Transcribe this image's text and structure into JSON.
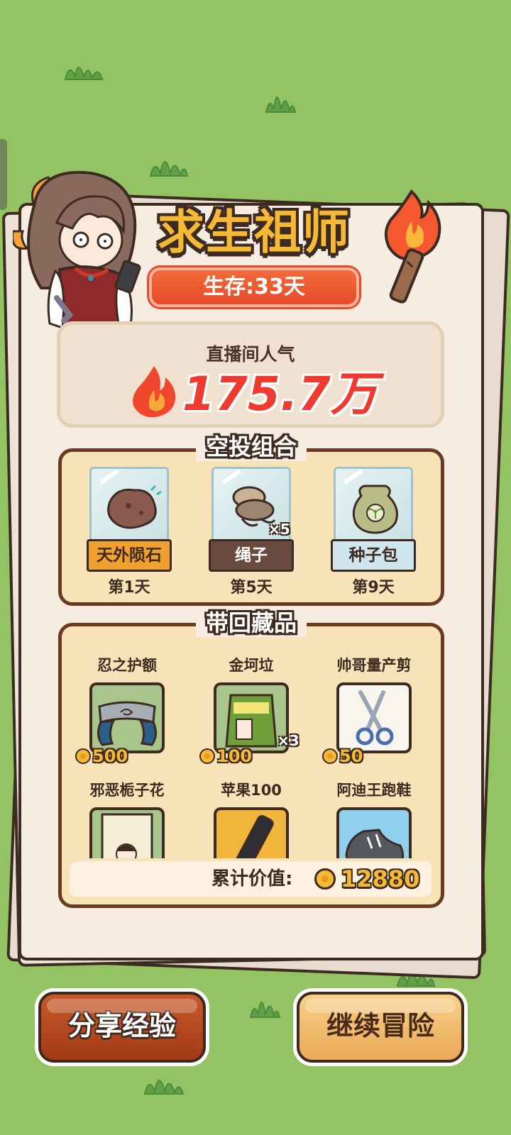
{
  "header": {
    "title": "求生祖师",
    "survival": "生存:33天"
  },
  "popularity": {
    "label": "直播间人气",
    "value": "175.7万"
  },
  "airdrop": {
    "title": "空投组合",
    "items": [
      {
        "name": "天外陨石",
        "day": "第1天",
        "qty": "",
        "label_bg": "#f0a02e",
        "label_color": "#3d2b22"
      },
      {
        "name": "绳子",
        "day": "第5天",
        "qty": "×5",
        "label_bg": "#6a4a3e",
        "label_color": "#ffffff"
      },
      {
        "name": "种子包",
        "day": "第9天",
        "qty": "",
        "label_bg": "#cfe6ee",
        "label_color": "#3d2b22"
      }
    ]
  },
  "collection": {
    "title": "带回藏品",
    "items": [
      {
        "name": "忍之护额",
        "price": "500",
        "qty": "",
        "icon": "headband-icon"
      },
      {
        "name": "金坷垃",
        "price": "100",
        "qty": "×3",
        "icon": "fertilizer-bag-icon"
      },
      {
        "name": "帅哥量产剪",
        "price": "50",
        "qty": "",
        "icon": "scissors-icon"
      },
      {
        "name": "邪恶栀子花",
        "price": "",
        "qty": "",
        "icon": "book-icon"
      },
      {
        "name": "苹果100",
        "price": "",
        "qty": "",
        "icon": "phone-icon"
      },
      {
        "name": "阿迪王跑鞋",
        "price": "",
        "qty": "",
        "icon": "sneaker-icon"
      }
    ],
    "total_label": "累计价值:",
    "total_value": "12880"
  },
  "buttons": {
    "share": "分享经验",
    "continue": "继续冒险"
  },
  "colors": {
    "background": "#94c364",
    "accent_red": "#ef3b2f",
    "gold": "#f6b935",
    "brown": "#3d2b22"
  }
}
